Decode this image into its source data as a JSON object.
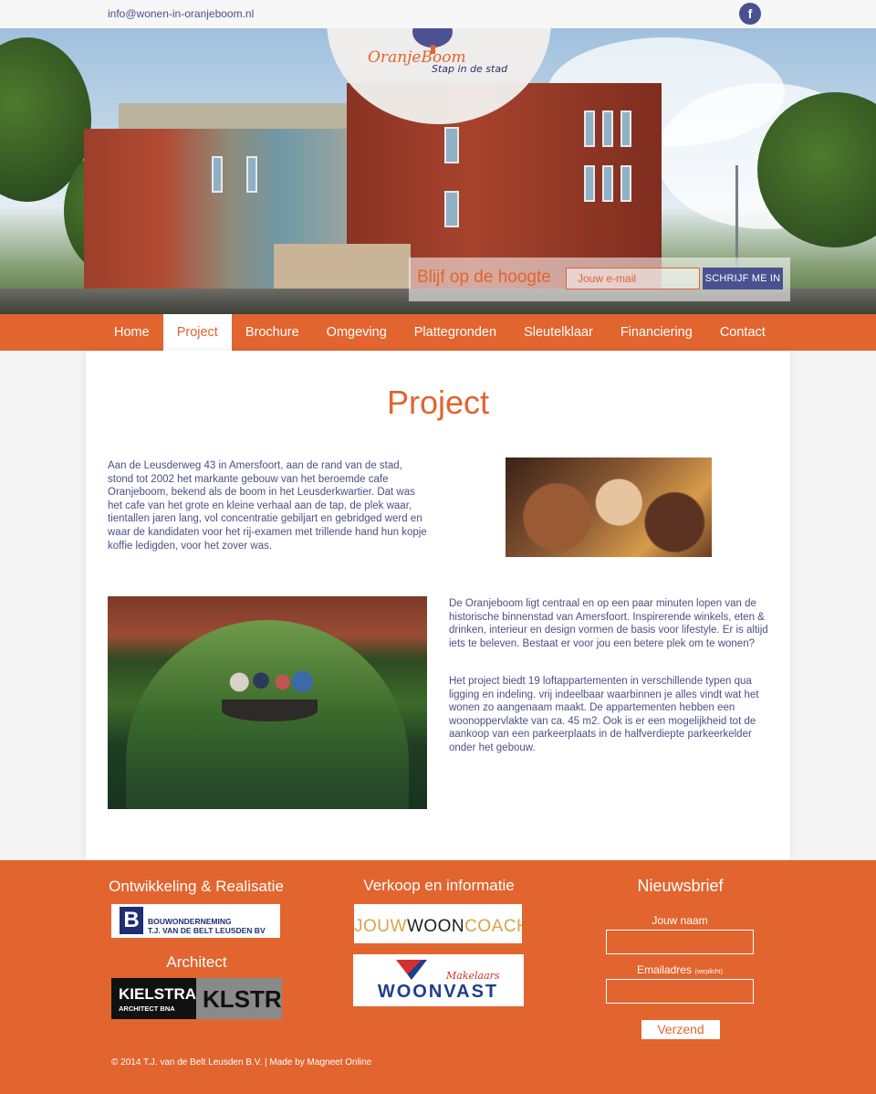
{
  "topbar": {
    "email": "info@wonen-in-oranjeboom.nl",
    "facebook_glyph": "f",
    "facebook_icon": "facebook-icon"
  },
  "logo": {
    "name": "OranjeBoom",
    "tagline": "Stap in de stad"
  },
  "subscribe": {
    "label": "Blijf op de hoogte",
    "placeholder": "Jouw e-mail",
    "button": "SCHRIJF ME IN"
  },
  "nav": {
    "items": [
      {
        "label": "Home",
        "active": false
      },
      {
        "label": "Project",
        "active": true
      },
      {
        "label": "Brochure",
        "active": false
      },
      {
        "label": "Omgeving",
        "active": false
      },
      {
        "label": "Plattegronden",
        "active": false
      },
      {
        "label": "Sleutelklaar",
        "active": false
      },
      {
        "label": "Financiering",
        "active": false
      },
      {
        "label": "Contact",
        "active": false
      }
    ]
  },
  "main": {
    "title": "Project",
    "paragraph1": "Aan de Leusderweg 43 in Amersfoort, aan de rand van de stad, stond tot 2002 het markante gebouw van het beroemde cafe Oranjeboom, bekend als de boom in het Leusderkwartier. Dat was het cafe van het grote en kleine verhaal aan de tap, de plek waar, tientallen jaren lang, vol concentratie gebiljart en gebridged werd en waar de kandidaten voor het rij-examen met trillende hand hun kopje koffie ledigden, voor het zover was.",
    "paragraph2": "De Oranjeboom ligt centraal en op een paar minuten lopen van de historische binnenstad van Amersfoort. Inspirerende winkels, eten & drinken, interieur en design vormen de basis voor lifestyle. Er is altijd iets te beleven. Bestaat er voor jou een betere plek om te wonen?",
    "paragraph3": "Het project biedt 19 loftappartementen in verschillende typen qua ligging en indeling. vrij indeelbaar waarbinnen je alles vindt wat het wonen zo aangenaam maakt. De appartementen hebben een woonoppervlakte van ca. 45 m2. Ook is er een mogelijkheid tot de aankoop van een parkeerplaats in de halfverdiepte parkeerkelder onder het gebouw."
  },
  "footer": {
    "col1_title": "Ontwikkeling & Realisatie",
    "belt_line1": "BOUWONDERNEMING",
    "belt_line2": "T.J. VAN DE BELT LEUSDEN BV",
    "belt_letter": "B",
    "architect_title": "Architect",
    "kielstra_name": "KIELSTRA",
    "kielstra_sub": "ARCHITECT BNA",
    "klstr": "KLSTR",
    "col2_title": "Verkoop en informatie",
    "jwc_a": "JOUW",
    "jwc_b": "WOON",
    "jwc_c": "COACH",
    "woonvast_tag": "Makelaars",
    "woonvast_name": "WOONVAST",
    "col3_title": "Nieuwsbrief",
    "name_label": "Jouw naam",
    "email_label": "Emailadres",
    "email_required": "(verplicht)",
    "submit": "Verzend",
    "copyright": "© 2014 T.J. van de Belt Leusden B.V. | Made by Magneet Online"
  },
  "colors": {
    "accent": "#e2642f",
    "navy": "#4a5190",
    "text": "#4a4f86"
  }
}
